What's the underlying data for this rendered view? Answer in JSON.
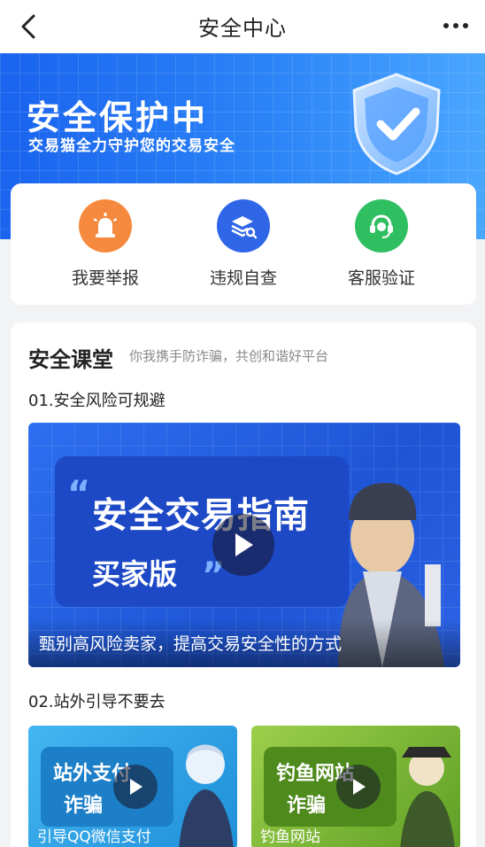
{
  "nav": {
    "title": "安全中心",
    "back_icon": "chevron-left-icon",
    "more_icon": "more-dots-icon"
  },
  "hero": {
    "title": "安全保护中",
    "subtitle": "交易猫全力守护您的交易安全",
    "shield_icon": "shield-check-icon"
  },
  "actions": [
    {
      "label": "我要举报",
      "icon": "alarm-siren-icon",
      "color": "#f5893d"
    },
    {
      "label": "违规自查",
      "icon": "layers-search-icon",
      "color": "#2f66e8"
    },
    {
      "label": "客服验证",
      "icon": "headset-icon",
      "color": "#2fbf61"
    }
  ],
  "lesson": {
    "title": "安全课堂",
    "slogan": "你我携手防诈骗，共创和谐好平台",
    "section1": {
      "heading": "01.安全风险可规避",
      "video": {
        "title": "安全交易指南",
        "subtitle": "买家版",
        "caption": "甄别高风险卖家，提高交易安全性的方式"
      }
    },
    "section2": {
      "heading": "02.站外引导不要去",
      "videos": [
        {
          "title_line1": "站外支付",
          "title_line2": "诈骗",
          "caption": "引导QQ微信支付",
          "color": "#2aa0e6"
        },
        {
          "title_line1": "钓鱼网站",
          "title_line2": "诈骗",
          "caption": "钓鱼网站",
          "color": "#6cae2e"
        }
      ]
    }
  },
  "colors": {
    "hero_start": "#1a63ee",
    "hero_end": "#4aa7ff"
  }
}
